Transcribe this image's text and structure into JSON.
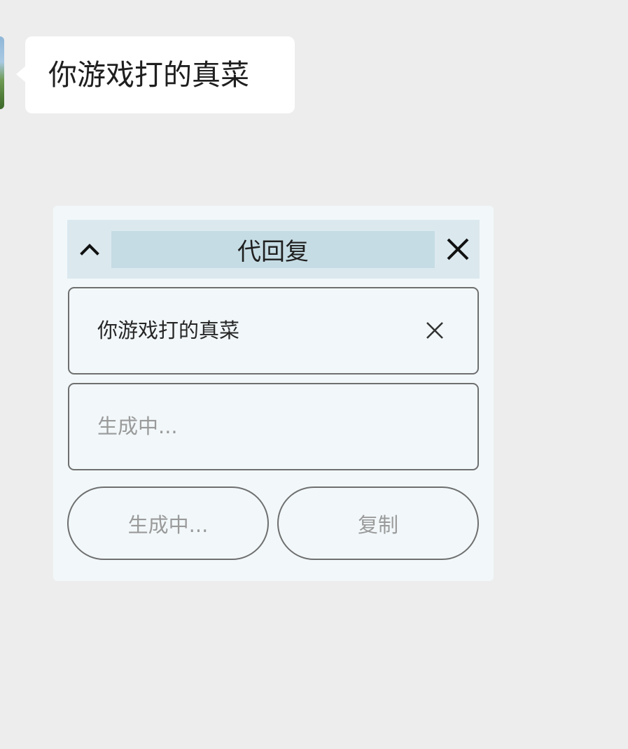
{
  "chat": {
    "message": "你游戏打的真菜"
  },
  "panel": {
    "title": "代回复",
    "collapse_icon": "chevron-up-icon",
    "close_icon": "close-icon",
    "source_text": "你游戏打的真菜",
    "clear_icon": "clear-icon",
    "reply_placeholder": "生成中...",
    "generate_label": "生成中...",
    "copy_label": "复制"
  },
  "colors": {
    "background": "#ededed",
    "bubble": "#ffffff",
    "panel": "#f2f8fa",
    "header": "#dbe9ef",
    "title_highlight": "#c6dce4",
    "border": "#6f6f6f",
    "muted_text": "#9a9a9a"
  }
}
